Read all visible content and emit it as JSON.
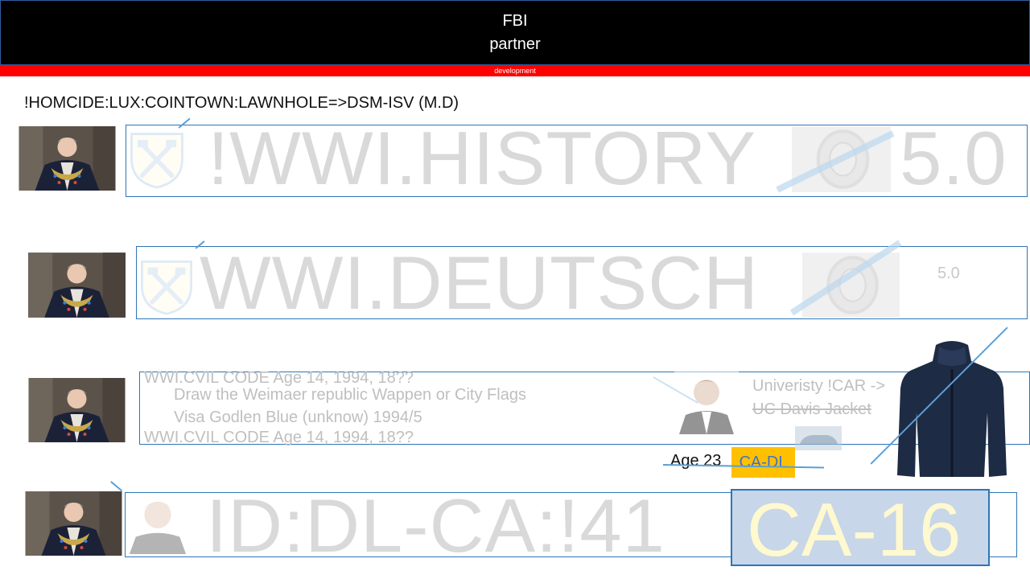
{
  "header": {
    "title_line1": "FBI",
    "title_line2": "partner",
    "bar_label": "development"
  },
  "subtitle": "!HOMCIDE:LUX:COINTOWN:LAWNHOLE=>DSM-ISV (M.D)",
  "rows": [
    {
      "big_text": "!WWI.HISTORY",
      "right_text": "5.0"
    },
    {
      "big_text": "WWI.DEUTSCH",
      "right_text": "5.0"
    },
    {
      "lines": [
        "WWI.CVIL CODE Age 14, 1994, 18??",
        "Draw the Weimaer republic Wappen or City Flags",
        "Visa Godlen Blue (unknow) 1994/5",
        "WWI.CVIL CODE Age 14, 1994, 18??"
      ],
      "univ_line1": "Univeristy !CAR ->",
      "univ_line2": "UC Davis Jacket"
    },
    {
      "big_text": "ID:DL-CA:!41"
    }
  ],
  "age_label": "Age 23",
  "ca_dl": "CA-DL",
  "ca_16": "CA-16",
  "colors": {
    "header_bg": "#000000",
    "dev_bar": "#ff0000",
    "box_border": "#2e75b6",
    "badge": "#ffc000"
  },
  "icons": [
    "portrait-photo",
    "coat-of-arms-icon",
    "wheel-photo",
    "jacket-photo",
    "person-photo",
    "car-photo"
  ]
}
